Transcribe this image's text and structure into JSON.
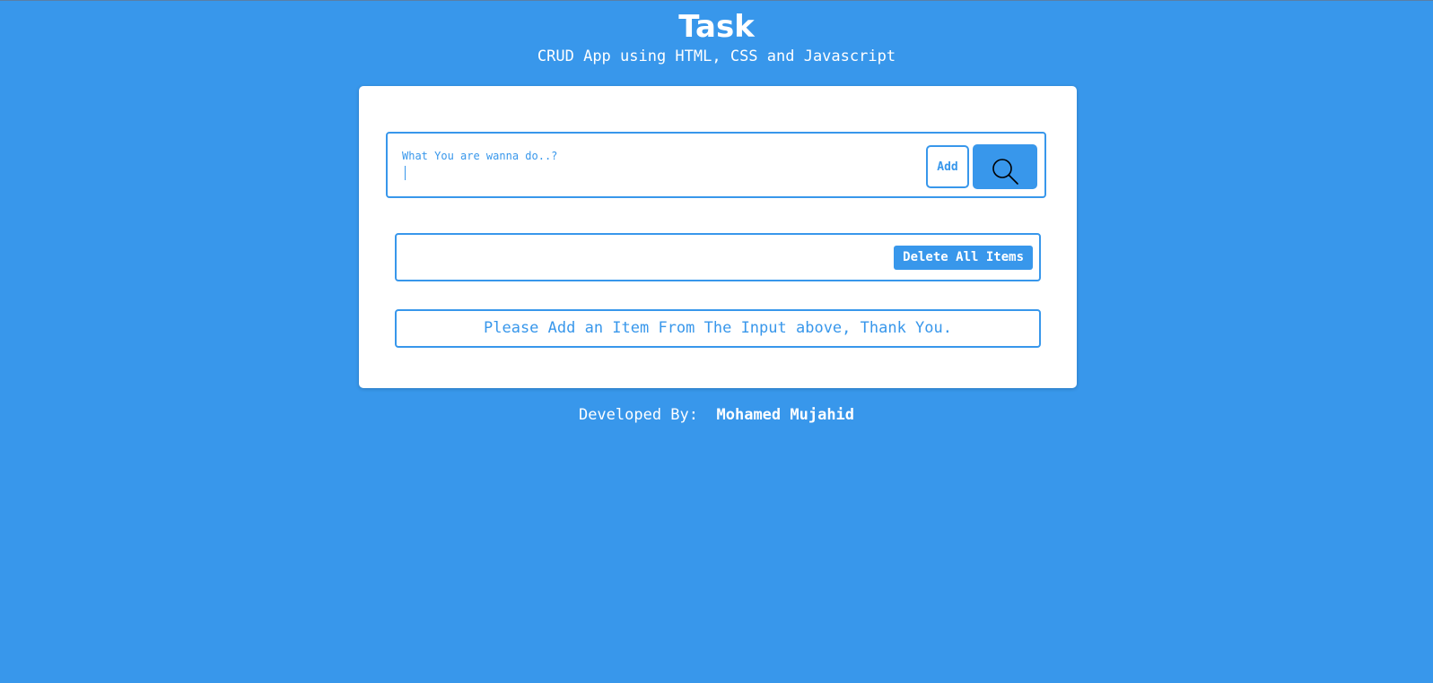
{
  "header": {
    "title": "Task",
    "subtitle": "CRUD App using HTML, CSS and Javascript"
  },
  "input": {
    "placeholder": "What You are wanna do..?",
    "value": ""
  },
  "buttons": {
    "add_label": "Add",
    "search_icon": "search-icon",
    "delete_all_label": "Delete All Items"
  },
  "list": {
    "empty_message": "Please Add an Item From The Input above, Thank You."
  },
  "footer": {
    "label": "Developed By:",
    "author": "Mohamed Mujahid"
  },
  "colors": {
    "background": "#3897eb",
    "card": "#ffffff",
    "accent": "#3897eb",
    "text_on_accent": "#ffffff"
  }
}
